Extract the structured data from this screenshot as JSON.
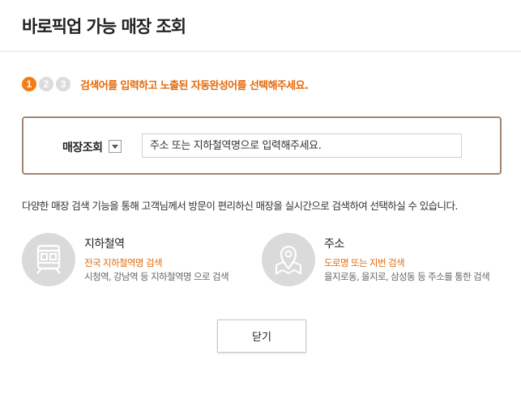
{
  "header": {
    "title": "바로픽업 가능 매장 조회"
  },
  "steps": {
    "items": [
      "1",
      "2",
      "3"
    ],
    "active_index": 1,
    "instruction": "검색어를 입력하고 노출된 자동완성어를 선택해주세요."
  },
  "search": {
    "label": "매장조회",
    "placeholder": "주소 또는 지하철역명으로 입력해주세요."
  },
  "description": "다양한 매장 검색 기능을 통해 고객님께서 방문이 편리하신 매장을 실시간으로 검색하여 선택하실 수 있습니다.",
  "options": [
    {
      "icon": "subway-train-icon",
      "title": "지하철역",
      "subtitle": "전국 지하철역명 검색",
      "example": "시청역, 강남역 등 지하철역명 으로 검색"
    },
    {
      "icon": "map-pin-icon",
      "title": "주소",
      "subtitle": "도로명 또는 지번 검색",
      "example": "을지로동, 을지로, 삼성동 등 주소를 통한 검색"
    }
  ],
  "close_label": "닫기",
  "colors": {
    "accent": "#e56a0a",
    "step_active": "#f57c14",
    "border": "#a2846f",
    "icon_bg": "#dadada"
  }
}
